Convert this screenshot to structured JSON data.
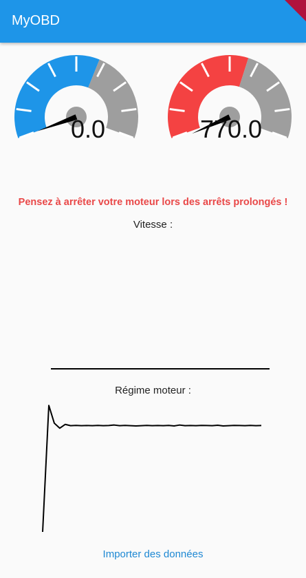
{
  "app": {
    "title": "MyOBD"
  },
  "gauges": [
    {
      "name": "speed",
      "value_label": "0.0",
      "value": 0.0,
      "max": 240,
      "fill_fraction": 0.6,
      "fill_color": "#1e95e8",
      "rest_color": "#9e9e9e"
    },
    {
      "name": "rpm",
      "value_label": "770.0",
      "value": 770.0,
      "max": 8000,
      "fill_fraction": 0.58,
      "fill_color": "#f44242",
      "rest_color": "#9e9e9e"
    }
  ],
  "warning": "Pensez à arrêter votre moteur lors des arrêts prolongés !",
  "speed_chart": {
    "label": "Vitesse :",
    "chart_data": {
      "type": "line",
      "series": [
        {
          "values": [
            0,
            0,
            0,
            0,
            0,
            0,
            0,
            0,
            0,
            0,
            0,
            0,
            0,
            0,
            0,
            0,
            0,
            0,
            0,
            0
          ]
        }
      ]
    }
  },
  "rpm_chart": {
    "label": "Régime moteur :",
    "chart_data": {
      "type": "line",
      "series": [
        {
          "values": [
            0,
            1000,
            860,
            820,
            850,
            840,
            842,
            840,
            841,
            840,
            842,
            840,
            841,
            845,
            840,
            842,
            840,
            838,
            840,
            842,
            840,
            841,
            840,
            842,
            838,
            845,
            840,
            841,
            840,
            842,
            841,
            840,
            843,
            838,
            840,
            842,
            841,
            840,
            842,
            840,
            841
          ]
        }
      ],
      "ylim": [
        0,
        1050
      ]
    }
  },
  "actions": {
    "import_label": "Importer des données"
  },
  "colors": {
    "primary": "#1e95e8",
    "warning": "#e94848",
    "link": "#1e88d3"
  }
}
